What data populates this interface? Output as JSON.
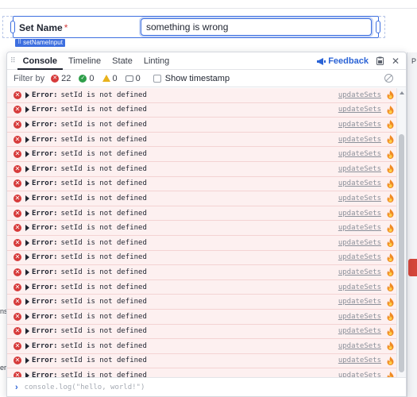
{
  "form": {
    "label": "Set Name",
    "required_marker": "*",
    "input_value": "something is wrong",
    "component_name": "setNameInput"
  },
  "console": {
    "tabs": [
      {
        "label": "Console",
        "active": true
      },
      {
        "label": "Timeline",
        "active": false
      },
      {
        "label": "State",
        "active": false
      },
      {
        "label": "Linting",
        "active": false
      }
    ],
    "feedback_label": "Feedback",
    "filter": {
      "label": "Filter by",
      "error_count": "22",
      "success_count": "0",
      "warning_count": "0",
      "message_count": "0",
      "timestamp_label": "Show timestamp"
    },
    "log_rows": [
      {
        "prefix": "Error:",
        "message": "setId is not defined",
        "source": "updateSets"
      },
      {
        "prefix": "Error:",
        "message": "setId is not defined",
        "source": "updateSets"
      },
      {
        "prefix": "Error:",
        "message": "setId is not defined",
        "source": "updateSets"
      },
      {
        "prefix": "Error:",
        "message": "setId is not defined",
        "source": "updateSets"
      },
      {
        "prefix": "Error:",
        "message": "setId is not defined",
        "source": "updateSets"
      },
      {
        "prefix": "Error:",
        "message": "setId is not defined",
        "source": "updateSets"
      },
      {
        "prefix": "Error:",
        "message": "setId is not defined",
        "source": "updateSets"
      },
      {
        "prefix": "Error:",
        "message": "setId is not defined",
        "source": "updateSets"
      },
      {
        "prefix": "Error:",
        "message": "setId is not defined",
        "source": "updateSets"
      },
      {
        "prefix": "Error:",
        "message": "setId is not defined",
        "source": "updateSets"
      },
      {
        "prefix": "Error:",
        "message": "setId is not defined",
        "source": "updateSets"
      },
      {
        "prefix": "Error:",
        "message": "setId is not defined",
        "source": "updateSets"
      },
      {
        "prefix": "Error:",
        "message": "setId is not defined",
        "source": "updateSets"
      },
      {
        "prefix": "Error:",
        "message": "setId is not defined",
        "source": "updateSets"
      },
      {
        "prefix": "Error:",
        "message": "setId is not defined",
        "source": "updateSets"
      },
      {
        "prefix": "Error:",
        "message": "setId is not defined",
        "source": "updateSets"
      },
      {
        "prefix": "Error:",
        "message": "setId is not defined",
        "source": "updateSets"
      },
      {
        "prefix": "Error:",
        "message": "setId is not defined",
        "source": "updateSets"
      },
      {
        "prefix": "Error:",
        "message": "setId is not defined",
        "source": "updateSets"
      },
      {
        "prefix": "Error:",
        "message": "setId is not defined",
        "source": "updateSets"
      }
    ],
    "input_placeholder": "console.log(\"hello, world!\")"
  },
  "background": {
    "right_peek_text": "P",
    "left_peek_texts": [
      "ns",
      "",
      "er"
    ]
  },
  "colors": {
    "accent": "#3d6fe0",
    "error": "#d63a3a",
    "error_row_bg": "#fdf0f0",
    "link": "#2b63d6"
  }
}
